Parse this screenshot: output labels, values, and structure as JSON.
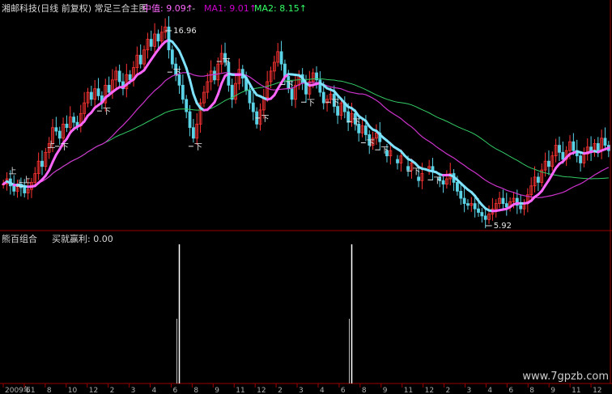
{
  "header": {
    "title": "湘邮科技(日线 前复权) 常足三合主图",
    "mid_label": "中值: 9.09↑",
    "mid_sep": ": -",
    "ma1_label": "MA1: 9.01↑",
    "ma2_label": "MA2: 8.15↑"
  },
  "sub_panel": {
    "title": "熊百组合",
    "indicator": "买就赢利: 0.00"
  },
  "watermark": "www.7gpzb.com",
  "colors": {
    "background": "#000000",
    "up_candle": "#ff3333",
    "down_candle": "#5ad3e6",
    "mid_line": "#ff66ff",
    "ma1_line": "#cc33cc",
    "ma2_line": "#33cc66",
    "trend_line": "#7fe3ff",
    "grid": "#9a0000",
    "annotation": "#e6e6e6",
    "signal_bar": "#ffffff"
  },
  "chart_data": {
    "type": "candlestick",
    "x_tick_labels": [
      "2009年1",
      "6",
      "8",
      "10",
      "12",
      "2",
      "3",
      "4",
      "6",
      "8",
      "9",
      "11",
      "12",
      "2",
      "3",
      "4",
      "6",
      "8",
      "9",
      "11",
      "12",
      "2",
      "3",
      "4",
      "6",
      "8",
      "9",
      "11",
      "12"
    ],
    "y_range": [
      5.6,
      17.6
    ],
    "price_annotations": [
      {
        "label": "16.96",
        "value": 16.96,
        "bar_index": 46
      },
      {
        "label": "5.92",
        "value": 5.92,
        "bar_index": 137
      }
    ],
    "sell_marker": "下",
    "buy_marker": "上",
    "sell_marker_bars": [
      16,
      28,
      48,
      54,
      62,
      73,
      80,
      86,
      93,
      99,
      103,
      107,
      116,
      122
    ],
    "buy_marker_bars": [
      1,
      3,
      12,
      5
    ],
    "closes": [
      8.0,
      8.3,
      7.9,
      7.6,
      8.0,
      7.8,
      7.5,
      7.7,
      8.1,
      8.6,
      9.3,
      9.0,
      9.8,
      10.3,
      11.2,
      11.0,
      10.6,
      11.4,
      11.2,
      11.8,
      11.5,
      11.3,
      12.0,
      12.6,
      13.2,
      12.8,
      13.4,
      13.0,
      12.6,
      13.6,
      13.2,
      13.9,
      14.4,
      13.8,
      13.4,
      14.2,
      13.9,
      14.6,
      15.3,
      14.8,
      15.6,
      16.2,
      15.8,
      16.5,
      16.1,
      16.6,
      16.9,
      15.6,
      14.8,
      14.2,
      13.6,
      12.8,
      12.1,
      11.2,
      10.6,
      11.4,
      12.6,
      13.2,
      13.8,
      14.4,
      13.9,
      14.8,
      15.4,
      14.9,
      13.6,
      12.8,
      13.7,
      14.5,
      14.0,
      13.3,
      12.6,
      12.1,
      11.4,
      12.2,
      12.9,
      13.8,
      14.4,
      14.9,
      15.5,
      14.8,
      14.1,
      13.4,
      12.8,
      13.6,
      14.2,
      13.7,
      13.1,
      13.8,
      14.3,
      13.9,
      13.2,
      12.6,
      12.8,
      13.1,
      12.4,
      11.9,
      12.6,
      12.1,
      11.5,
      12.0,
      11.4,
      10.9,
      11.3,
      10.8,
      10.2,
      10.6,
      10.9,
      10.4,
      9.9,
      9.6,
      9.9,
      9.4,
      9.2,
      9.6,
      9.0,
      8.8,
      9.2,
      8.4,
      8.2,
      8.6,
      8.9,
      9.0,
      8.7,
      8.4,
      8.2,
      8.0,
      8.3,
      8.6,
      8.1,
      7.6,
      7.2,
      6.9,
      6.8,
      6.9,
      6.6,
      6.4,
      6.2,
      6.0,
      6.3,
      6.6,
      6.9,
      7.2,
      6.9,
      6.7,
      7.0,
      7.2,
      6.8,
      6.6,
      6.9,
      7.4,
      7.9,
      8.4,
      8.1,
      8.8,
      9.3,
      9.0,
      9.6,
      10.2,
      9.8,
      9.4,
      9.9,
      10.4,
      9.9,
      9.6,
      9.2,
      9.7,
      10.1,
      9.8,
      10.3,
      9.9,
      10.6,
      10.2,
      9.9
    ],
    "gap_bars": [
      [
        108,
        118
      ],
      [
        119,
        125
      ]
    ],
    "signal_bars": [
      {
        "bar_index": 50,
        "value": 1.0
      },
      {
        "bar_index": 99,
        "value": 1.0
      }
    ],
    "sub_panel_value": 0.0
  }
}
